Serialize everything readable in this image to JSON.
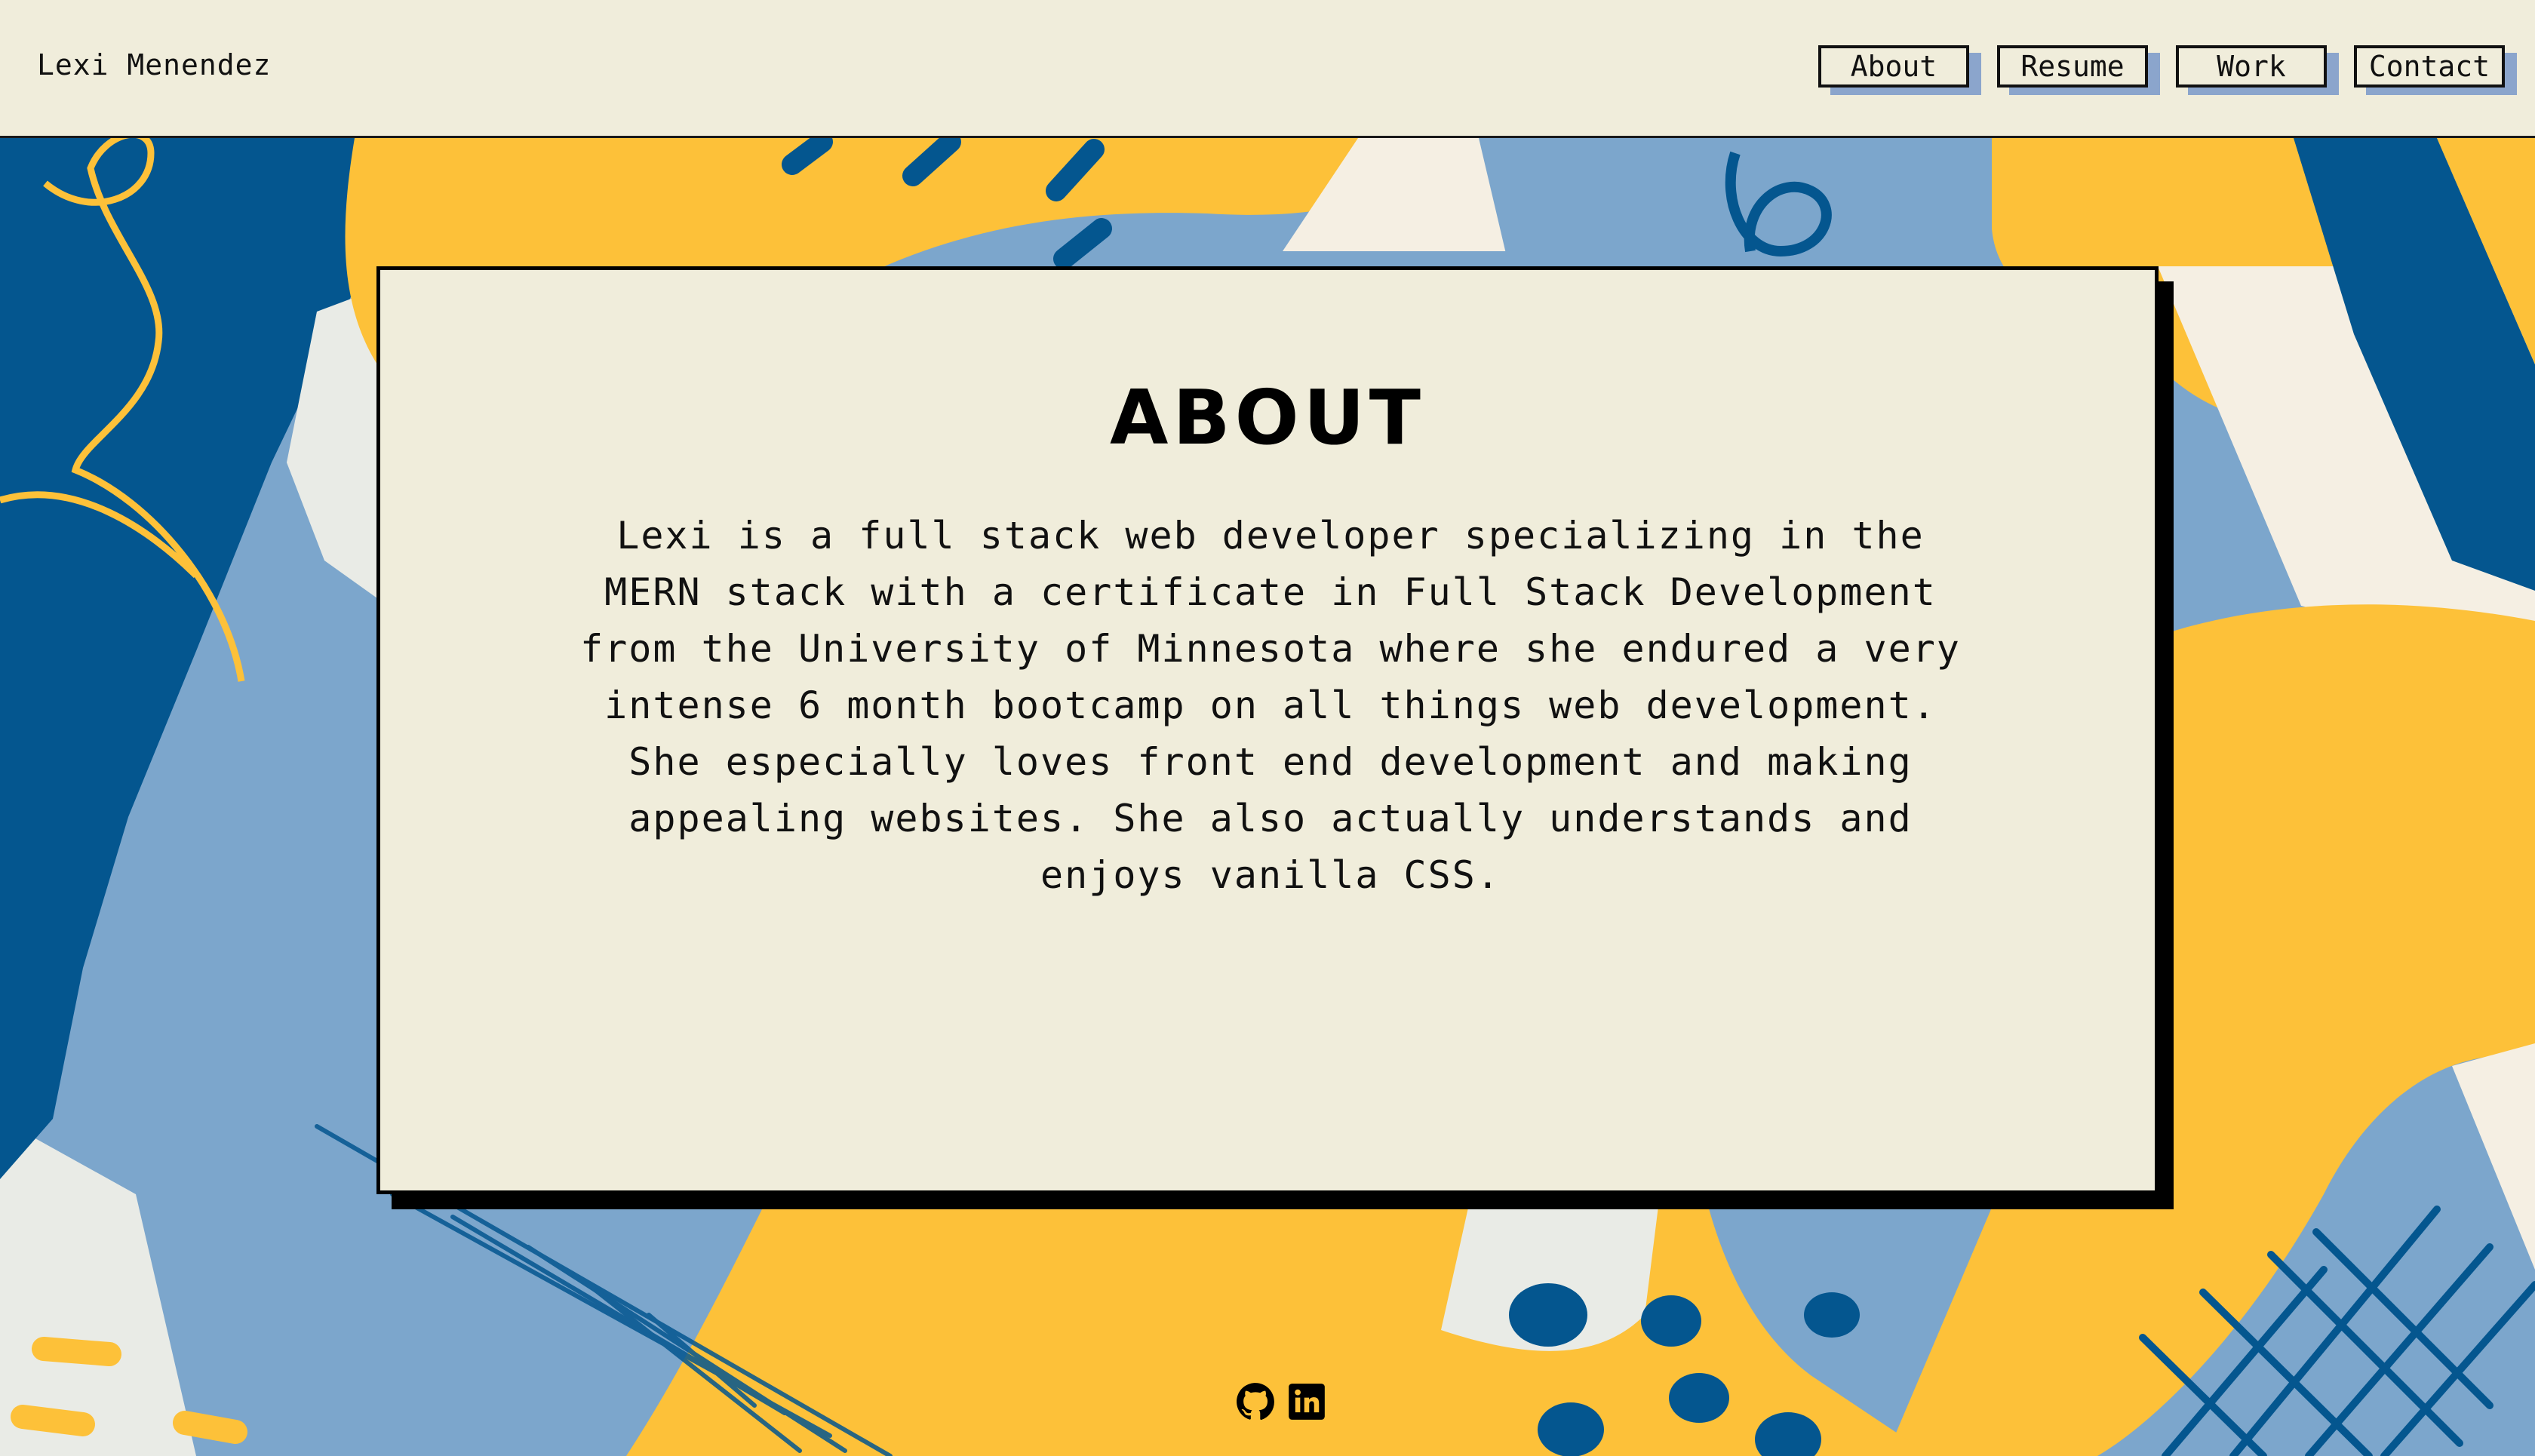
{
  "header": {
    "brand": "Lexi Menendez",
    "nav": [
      {
        "label": "About"
      },
      {
        "label": "Resume"
      },
      {
        "label": "Work"
      },
      {
        "label": "Contact"
      }
    ]
  },
  "about": {
    "title": "About",
    "body": "Lexi is a full stack web developer specializing in the MERN stack with a certificate in Full Stack Development from the University of Minnesota where she endured a very intense 6 month bootcamp on all things web development. She especially loves front end development and making appealing websites. She also actually understands and enjoys vanilla CSS."
  },
  "footer": {
    "icons": [
      "github-icon",
      "linkedin-icon"
    ]
  },
  "colors": {
    "cream": "#f0eddb",
    "navy": "#04568f",
    "lightblue": "#7ca6cc",
    "yellow": "#fdc139",
    "offwhite": "#e9ebe6",
    "nav_shadow": "#8ba5cc"
  }
}
